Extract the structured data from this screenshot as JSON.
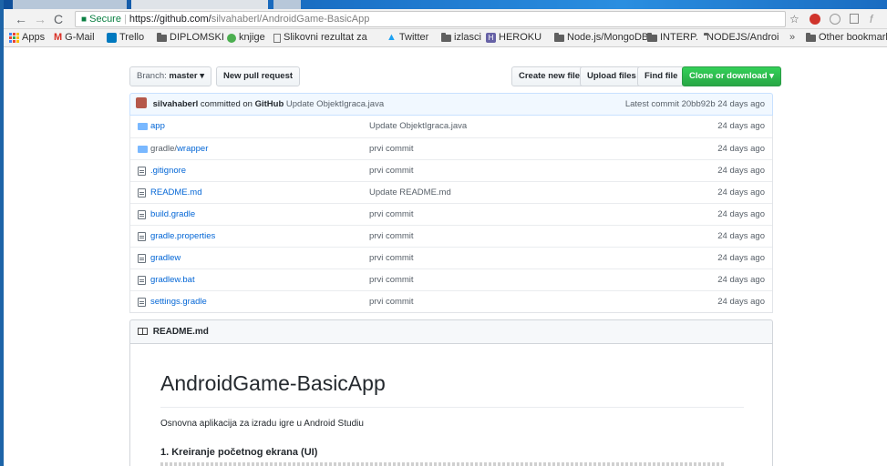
{
  "browser": {
    "address": {
      "secure_label": "Secure",
      "url_host": "https://github.com/",
      "url_path": "silvahaberl/AndroidGame-BasicApp"
    },
    "bookmarks": [
      {
        "label": "Apps",
        "icon": "apps-icon"
      },
      {
        "label": "G-Mail",
        "icon": "gmail-icon"
      },
      {
        "label": "Trello",
        "icon": "trello-icon"
      },
      {
        "label": "DIPLOMSKI",
        "icon": "folder-icon"
      },
      {
        "label": "knjige",
        "icon": "green-dot-icon"
      },
      {
        "label": "Slikovni rezultat za",
        "icon": "page-icon"
      },
      {
        "label": "Twitter",
        "icon": "twitter-icon"
      },
      {
        "label": "izlasci",
        "icon": "folder-icon"
      },
      {
        "label": "HEROKU",
        "icon": "heroku-icon"
      },
      {
        "label": "Node.js/MongoDB",
        "icon": "folder-icon"
      },
      {
        "label": "INTERP.",
        "icon": "folder-icon"
      },
      {
        "label": "NODEJS/AndroidA",
        "icon": "folder-icon"
      }
    ],
    "overflow_label": "»",
    "other_bookmarks": "Other bookmarks"
  },
  "repo": {
    "branch_prefix": "Branch:",
    "branch": "master",
    "new_pull_request": "New pull request",
    "create_new_file": "Create new file",
    "upload_files": "Upload files",
    "find_file": "Find file",
    "clone_download": "Clone or download"
  },
  "commit": {
    "author": "silvahaberl",
    "text": "committed on",
    "platform": "GitHub",
    "message": "Update ObjektIgraca.java",
    "latest_label": "Latest commit 20bb92b 24 days ago"
  },
  "files": [
    {
      "name": "app",
      "type": "dir",
      "message": "Update ObjektIgraca.java",
      "age": "24 days ago"
    },
    {
      "name_prefix": "gradle/",
      "name": "wrapper",
      "type": "dir",
      "message": "prvi commit",
      "age": "24 days ago"
    },
    {
      "name": ".gitignore",
      "type": "file",
      "message": "prvi commit",
      "age": "24 days ago"
    },
    {
      "name": "README.md",
      "type": "file",
      "message": "Update README.md",
      "age": "24 days ago"
    },
    {
      "name": "build.gradle",
      "type": "file",
      "message": "prvi commit",
      "age": "24 days ago"
    },
    {
      "name": "gradle.properties",
      "type": "file",
      "message": "prvi commit",
      "age": "24 days ago"
    },
    {
      "name": "gradlew",
      "type": "file",
      "message": "prvi commit",
      "age": "24 days ago"
    },
    {
      "name": "gradlew.bat",
      "type": "file",
      "message": "prvi commit",
      "age": "24 days ago"
    },
    {
      "name": "settings.gradle",
      "type": "file",
      "message": "prvi commit",
      "age": "24 days ago"
    }
  ],
  "readme": {
    "header": "README.md",
    "title": "AndroidGame-BasicApp",
    "intro": "Osnovna aplikacija za izradu igre u Android Studiu",
    "section1": "1. Kreiranje početnog ekrana (UI)"
  }
}
